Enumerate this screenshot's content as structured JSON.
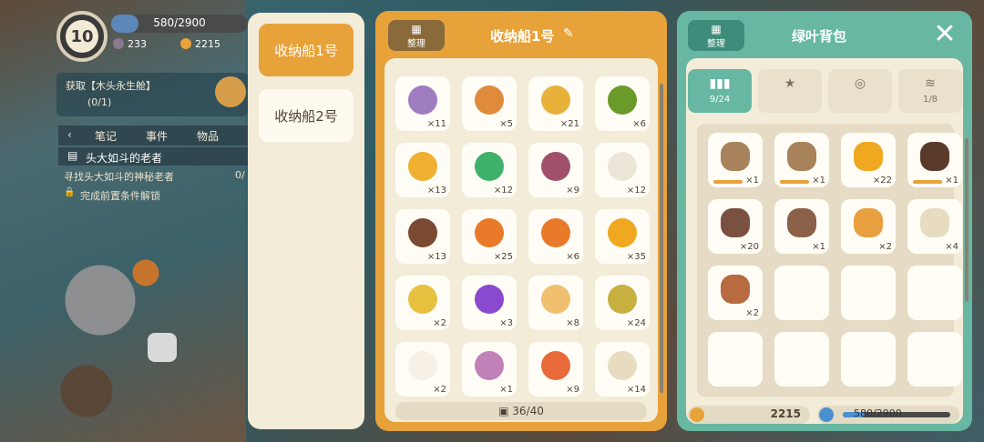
{
  "hud": {
    "level": "10",
    "energy_text": "580/2900",
    "energy_fraction": 0.2,
    "gems": "233",
    "coins": "2215",
    "quest_get": "获取【木头永生舱】",
    "quest_progress": "(0/1)",
    "tabs": [
      "笔记",
      "事件",
      "物品"
    ],
    "task_title": "头大如斗的老者",
    "task_desc": "寻找头大如斗的神秘老者",
    "task_count": "0/",
    "task_lock": "完成前置条件解锁"
  },
  "ships": {
    "items": [
      {
        "label": "收纳船1号",
        "active": true
      },
      {
        "label": "收纳船2号",
        "active": false
      }
    ]
  },
  "storage": {
    "sort_label": "整理",
    "title": "收纳船1号",
    "capacity": "36/40",
    "items": [
      {
        "icon": "seed-bag-purple-icon",
        "count": "×11",
        "color": "#a07cc0"
      },
      {
        "icon": "seed-bag-orange-icon",
        "count": "×5",
        "color": "#e08a3c"
      },
      {
        "icon": "seed-bag-yellow-icon",
        "count": "×21",
        "color": "#e8b23a"
      },
      {
        "icon": "green-bow-icon",
        "count": "×6",
        "color": "#6a9a2a"
      },
      {
        "icon": "yellow-flower-icon",
        "count": "×13",
        "color": "#f0b030"
      },
      {
        "icon": "green-gem-icon",
        "count": "×12",
        "color": "#3fb06a"
      },
      {
        "icon": "purple-onion-icon",
        "count": "×9",
        "color": "#a0506a"
      },
      {
        "icon": "mushroom-icon",
        "count": "×12",
        "color": "#ece6d8"
      },
      {
        "icon": "coconut-icon",
        "count": "×13",
        "color": "#7a4a32"
      },
      {
        "icon": "carrot-icon",
        "count": "×25",
        "color": "#e87a2a"
      },
      {
        "icon": "carrot-icon",
        "count": "×6",
        "color": "#e87a2a"
      },
      {
        "icon": "honey-orb-icon",
        "count": "×35",
        "color": "#f0a820"
      },
      {
        "icon": "yellow-potion-icon",
        "count": "×2",
        "color": "#e8c040"
      },
      {
        "icon": "purple-potion-icon",
        "count": "×3",
        "color": "#8a4ad0"
      },
      {
        "icon": "cream-cake-icon",
        "count": "×8",
        "color": "#f0c070"
      },
      {
        "icon": "honey-pot-icon",
        "count": "×24",
        "color": "#c8b040"
      },
      {
        "icon": "cream-bowl-icon",
        "count": "×2",
        "color": "#f6f0e6"
      },
      {
        "icon": "purple-cloth-icon",
        "count": "×1",
        "color": "#c080b8"
      },
      {
        "icon": "red-potion-icon",
        "count": "×9",
        "color": "#e86a3a"
      },
      {
        "icon": "beige-cloth-icon",
        "count": "×14",
        "color": "#e8dcc0"
      }
    ]
  },
  "backpack": {
    "sort_label": "整理",
    "title": "绿叶背包",
    "tabs": [
      {
        "icon": "grid-icon",
        "label": "9/24",
        "active": true
      },
      {
        "icon": "star-icon",
        "label": "",
        "active": false
      },
      {
        "icon": "jar-icon",
        "label": "",
        "active": false
      },
      {
        "icon": "wave-icon",
        "label": "1/8",
        "active": false
      }
    ],
    "items": [
      {
        "icon": "wooden-sword-icon",
        "count": "×1",
        "color": "#a8825a",
        "durability": 0.95
      },
      {
        "icon": "wooden-sword-icon",
        "count": "×1",
        "color": "#a8825a",
        "durability": 0.95
      },
      {
        "icon": "honey-orb-icon",
        "count": "×22",
        "color": "#f0a820"
      },
      {
        "icon": "pickaxe-icon",
        "count": "×1",
        "color": "#5a3a2a",
        "durability": 0.95
      },
      {
        "icon": "branch-icon",
        "count": "×20",
        "color": "#7a5040"
      },
      {
        "icon": "log-icon",
        "count": "×1",
        "color": "#8a6048"
      },
      {
        "icon": "honey-pot-icon",
        "count": "×2",
        "color": "#e8a040"
      },
      {
        "icon": "beige-cloth-icon",
        "count": "×4",
        "color": "#e8dcc0"
      },
      {
        "icon": "wood-plank-icon",
        "count": "×2",
        "color": "#b86a40"
      }
    ],
    "empty_slots": 7,
    "coins": "2215",
    "energy_text": "580/2900",
    "energy_fraction": 0.2,
    "colors": {
      "accent_orange": "#e8a23a",
      "accent_teal": "#67b7a3",
      "panel_bg": "#f3ecd9"
    }
  }
}
